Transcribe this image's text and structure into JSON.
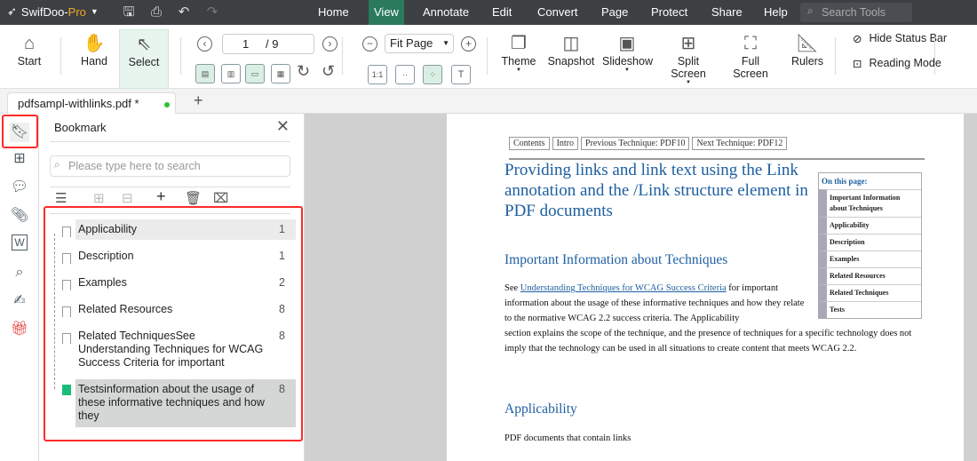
{
  "app": {
    "name": "SwifDoo-",
    "edition": "Pro"
  },
  "menu": [
    "Home",
    "View",
    "Annotate",
    "Edit",
    "Convert",
    "Page",
    "Protect",
    "Share",
    "Help"
  ],
  "active_menu": "View",
  "search_tools": {
    "placeholder": "Search Tools"
  },
  "toolbar": {
    "start": "Start",
    "hand": "Hand",
    "select": "Select",
    "page_current": "1",
    "page_total": "/ 9",
    "zoom": "Fit Page",
    "actual_size": "1:1",
    "theme": "Theme",
    "snapshot": "Snapshot",
    "slideshow": "Slideshow",
    "split_screen": "Split Screen",
    "full_screen": "Full Screen",
    "rulers": "Rulers",
    "hide_status_bar": "Hide Status Bar",
    "reading_mode": "Reading Mode"
  },
  "tab": {
    "label": "pdfsampl-withlinks.pdf *"
  },
  "bookmark_panel": {
    "title": "Bookmark",
    "search_placeholder": "Please type here to search",
    "items": [
      {
        "label": "Applicability",
        "page": "1"
      },
      {
        "label": "Description",
        "page": "1"
      },
      {
        "label": "Examples",
        "page": "2"
      },
      {
        "label": "Related Resources",
        "page": "8"
      },
      {
        "label": "Related TechniquesSee Understanding Techniques for WCAG Success Criteria for important",
        "page": "8"
      },
      {
        "label": "Testsinformation about the usage of these informative techniques and how they",
        "page": "8"
      }
    ]
  },
  "colors": {
    "accent": "#2a7a5e",
    "highlight": "#ff2a2a",
    "bookmark_active": "#1abc7a",
    "link": "#1d5fa0"
  },
  "document": {
    "nav": [
      "Contents",
      "Intro",
      "Previous Technique: PDF10",
      "Next Technique: PDF12"
    ],
    "title": "Providing links and link text using the Link annotation and the /Link structure element in PDF documents",
    "h_important": "Important Information about Techniques",
    "p1_before": "See ",
    "p1_link": "Understanding Techniques for WCAG Success Criteria",
    "p1_after": " for important information about the usage of these informative techniques and how they relate to the normative WCAG 2.2 success criteria. The Applicability",
    "p2": "section explains the scope of the technique, and the presence of techniques for a specific technology does not imply that the technology can be used in all situations to create content that meets WCAG 2.2.",
    "h_applicability": "Applicability",
    "p3": "PDF documents that contain links",
    "on_this_page": {
      "title": "On this page:",
      "items": [
        "Important Information about Techniques",
        "Applicability",
        "Description",
        "Examples",
        "Related Resources",
        "Related Techniques",
        "Tests"
      ]
    }
  }
}
